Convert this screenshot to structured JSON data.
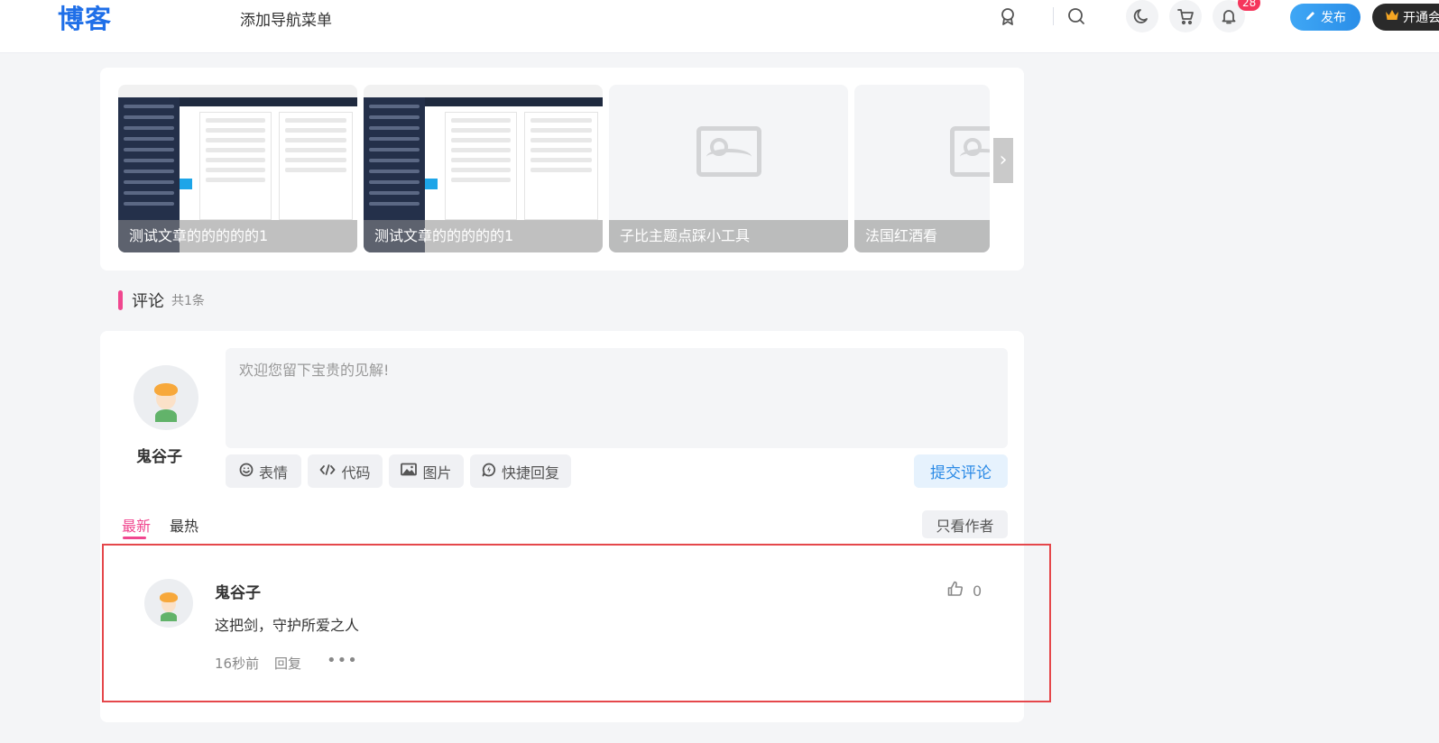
{
  "header": {
    "logo": "博客",
    "nav_text": "添加导航菜单",
    "notification_count": "28",
    "publish_label": "发布",
    "vip_label": "开通会"
  },
  "thumbnails": [
    {
      "title": "测试文章的的的的的1",
      "type": "screenshot"
    },
    {
      "title": "测试文章的的的的的1",
      "type": "screenshot"
    },
    {
      "title": "子比主题点踩小工具",
      "type": "placeholder"
    },
    {
      "title": "法国红酒看",
      "type": "placeholder"
    }
  ],
  "comments_section": {
    "title": "评论",
    "count_text": "共1条",
    "current_user": "鬼谷子",
    "textarea_placeholder": "欢迎您留下宝贵的见解!",
    "toolbar": {
      "emoji_label": "表情",
      "code_label": "代码",
      "image_label": "图片",
      "quick_reply_label": "快捷回复"
    },
    "submit_label": "提交评论",
    "tabs": {
      "newest": "最新",
      "hottest": "最热"
    },
    "author_only_label": "只看作者"
  },
  "comment": {
    "author": "鬼谷子",
    "text": "这把剑，守护所爱之人",
    "time": "16秒前",
    "reply_label": "回复",
    "more": "•••",
    "likes": "0"
  },
  "colors": {
    "brand": "#1f6fe8",
    "accent": "#f0478f",
    "submit_text": "#2b8ae6",
    "highlight_border": "#e5474b",
    "badge": "#f5365c"
  }
}
